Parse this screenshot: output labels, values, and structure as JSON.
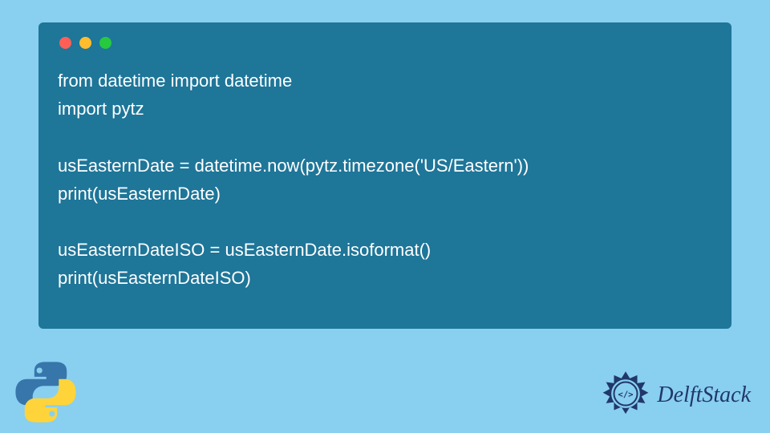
{
  "window": {
    "traffic_lights": {
      "red": "#ff5f56",
      "yellow": "#ffbd2e",
      "green": "#27c93f"
    }
  },
  "code": {
    "line1": "from datetime import datetime",
    "line2": "import pytz",
    "line3": "",
    "line4": "usEasternDate = datetime.now(pytz.timezone('US/Eastern'))",
    "line5": "print(usEasternDate)",
    "line6": "",
    "line7": "usEasternDateISO = usEasternDate.isoformat()",
    "line8": "print(usEasternDateISO)"
  },
  "branding": {
    "name": "DelftStack"
  },
  "colors": {
    "background": "#89cff0",
    "window_bg": "#1e7699",
    "code_text": "#ffffff",
    "brand_text": "#20386b"
  }
}
